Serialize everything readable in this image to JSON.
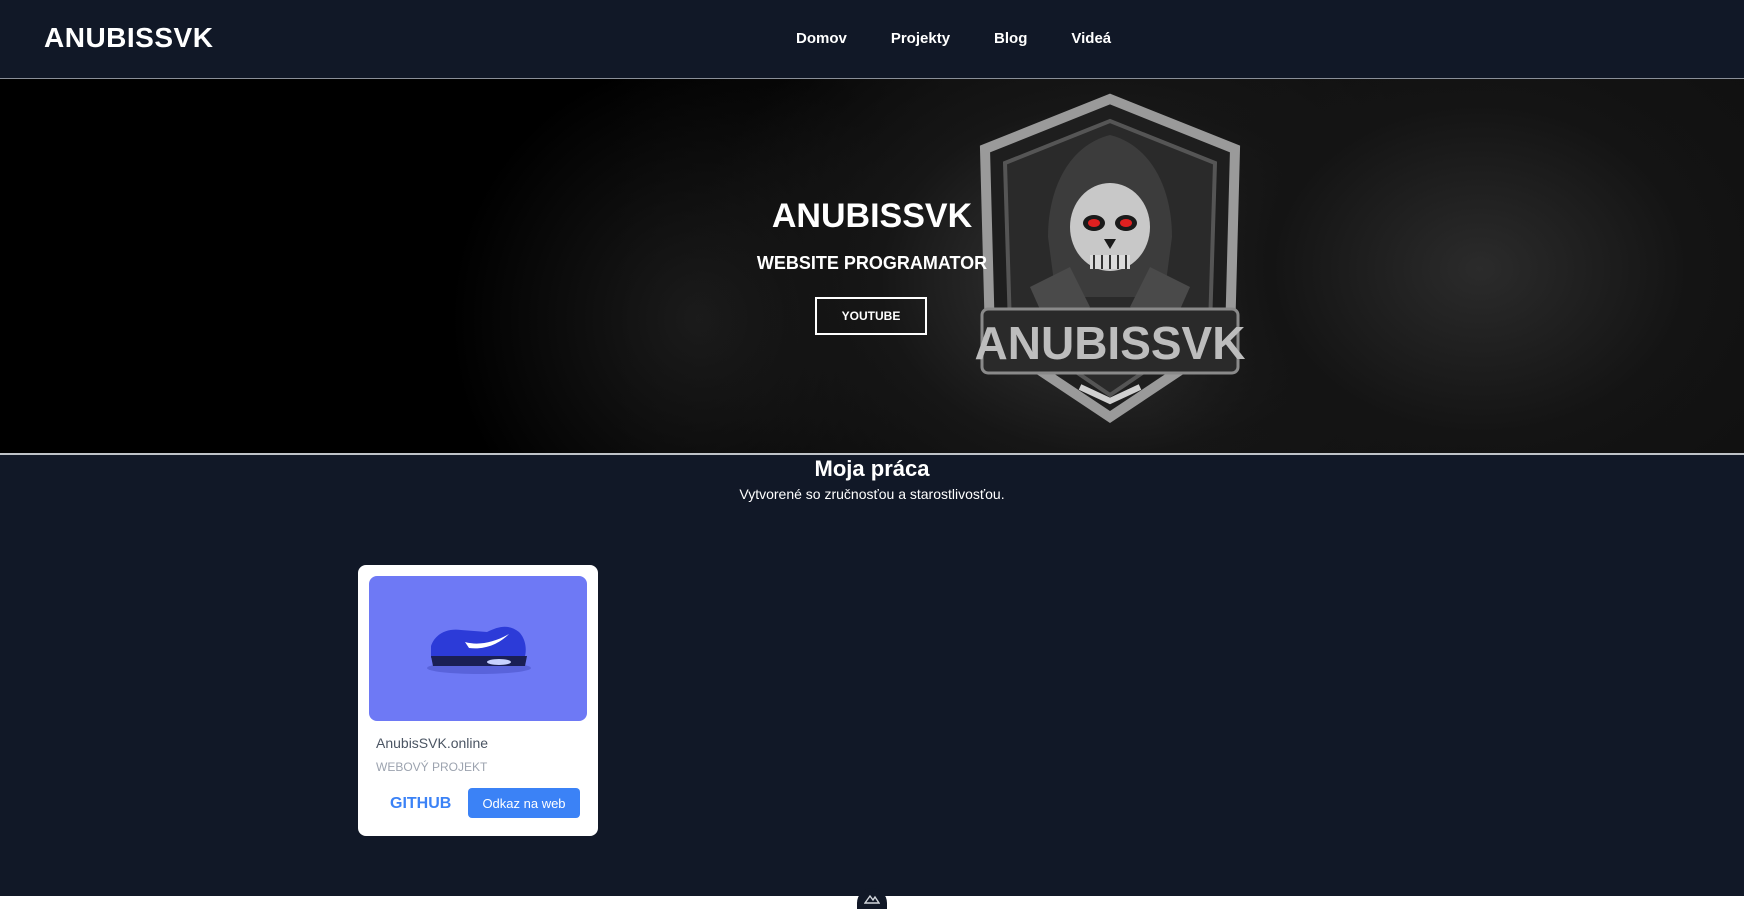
{
  "navbar": {
    "brand": "ANUBISSVK",
    "links": [
      "Domov",
      "Projekty",
      "Blog",
      "Videá"
    ]
  },
  "hero": {
    "title": "ANUBISSVK",
    "subtitle": "WEBSITE PROGRAMATOR",
    "button_label": "YOUTUBE",
    "logo_text": "ANUBISSVK"
  },
  "work": {
    "title": "Moja práca",
    "subtitle": "Vytvorené so zručnosťou a starostlivosťou.",
    "projects": [
      {
        "name": "AnubisSVK.online",
        "tag": "WEBOVÝ PROJEKT",
        "github_label": "GITHUB",
        "web_label": "Odkaz na web",
        "image_icon": "sneaker-icon"
      }
    ]
  },
  "colors": {
    "background": "#111827",
    "accent": "#3b82f6",
    "card_image": "#6e79f5"
  }
}
